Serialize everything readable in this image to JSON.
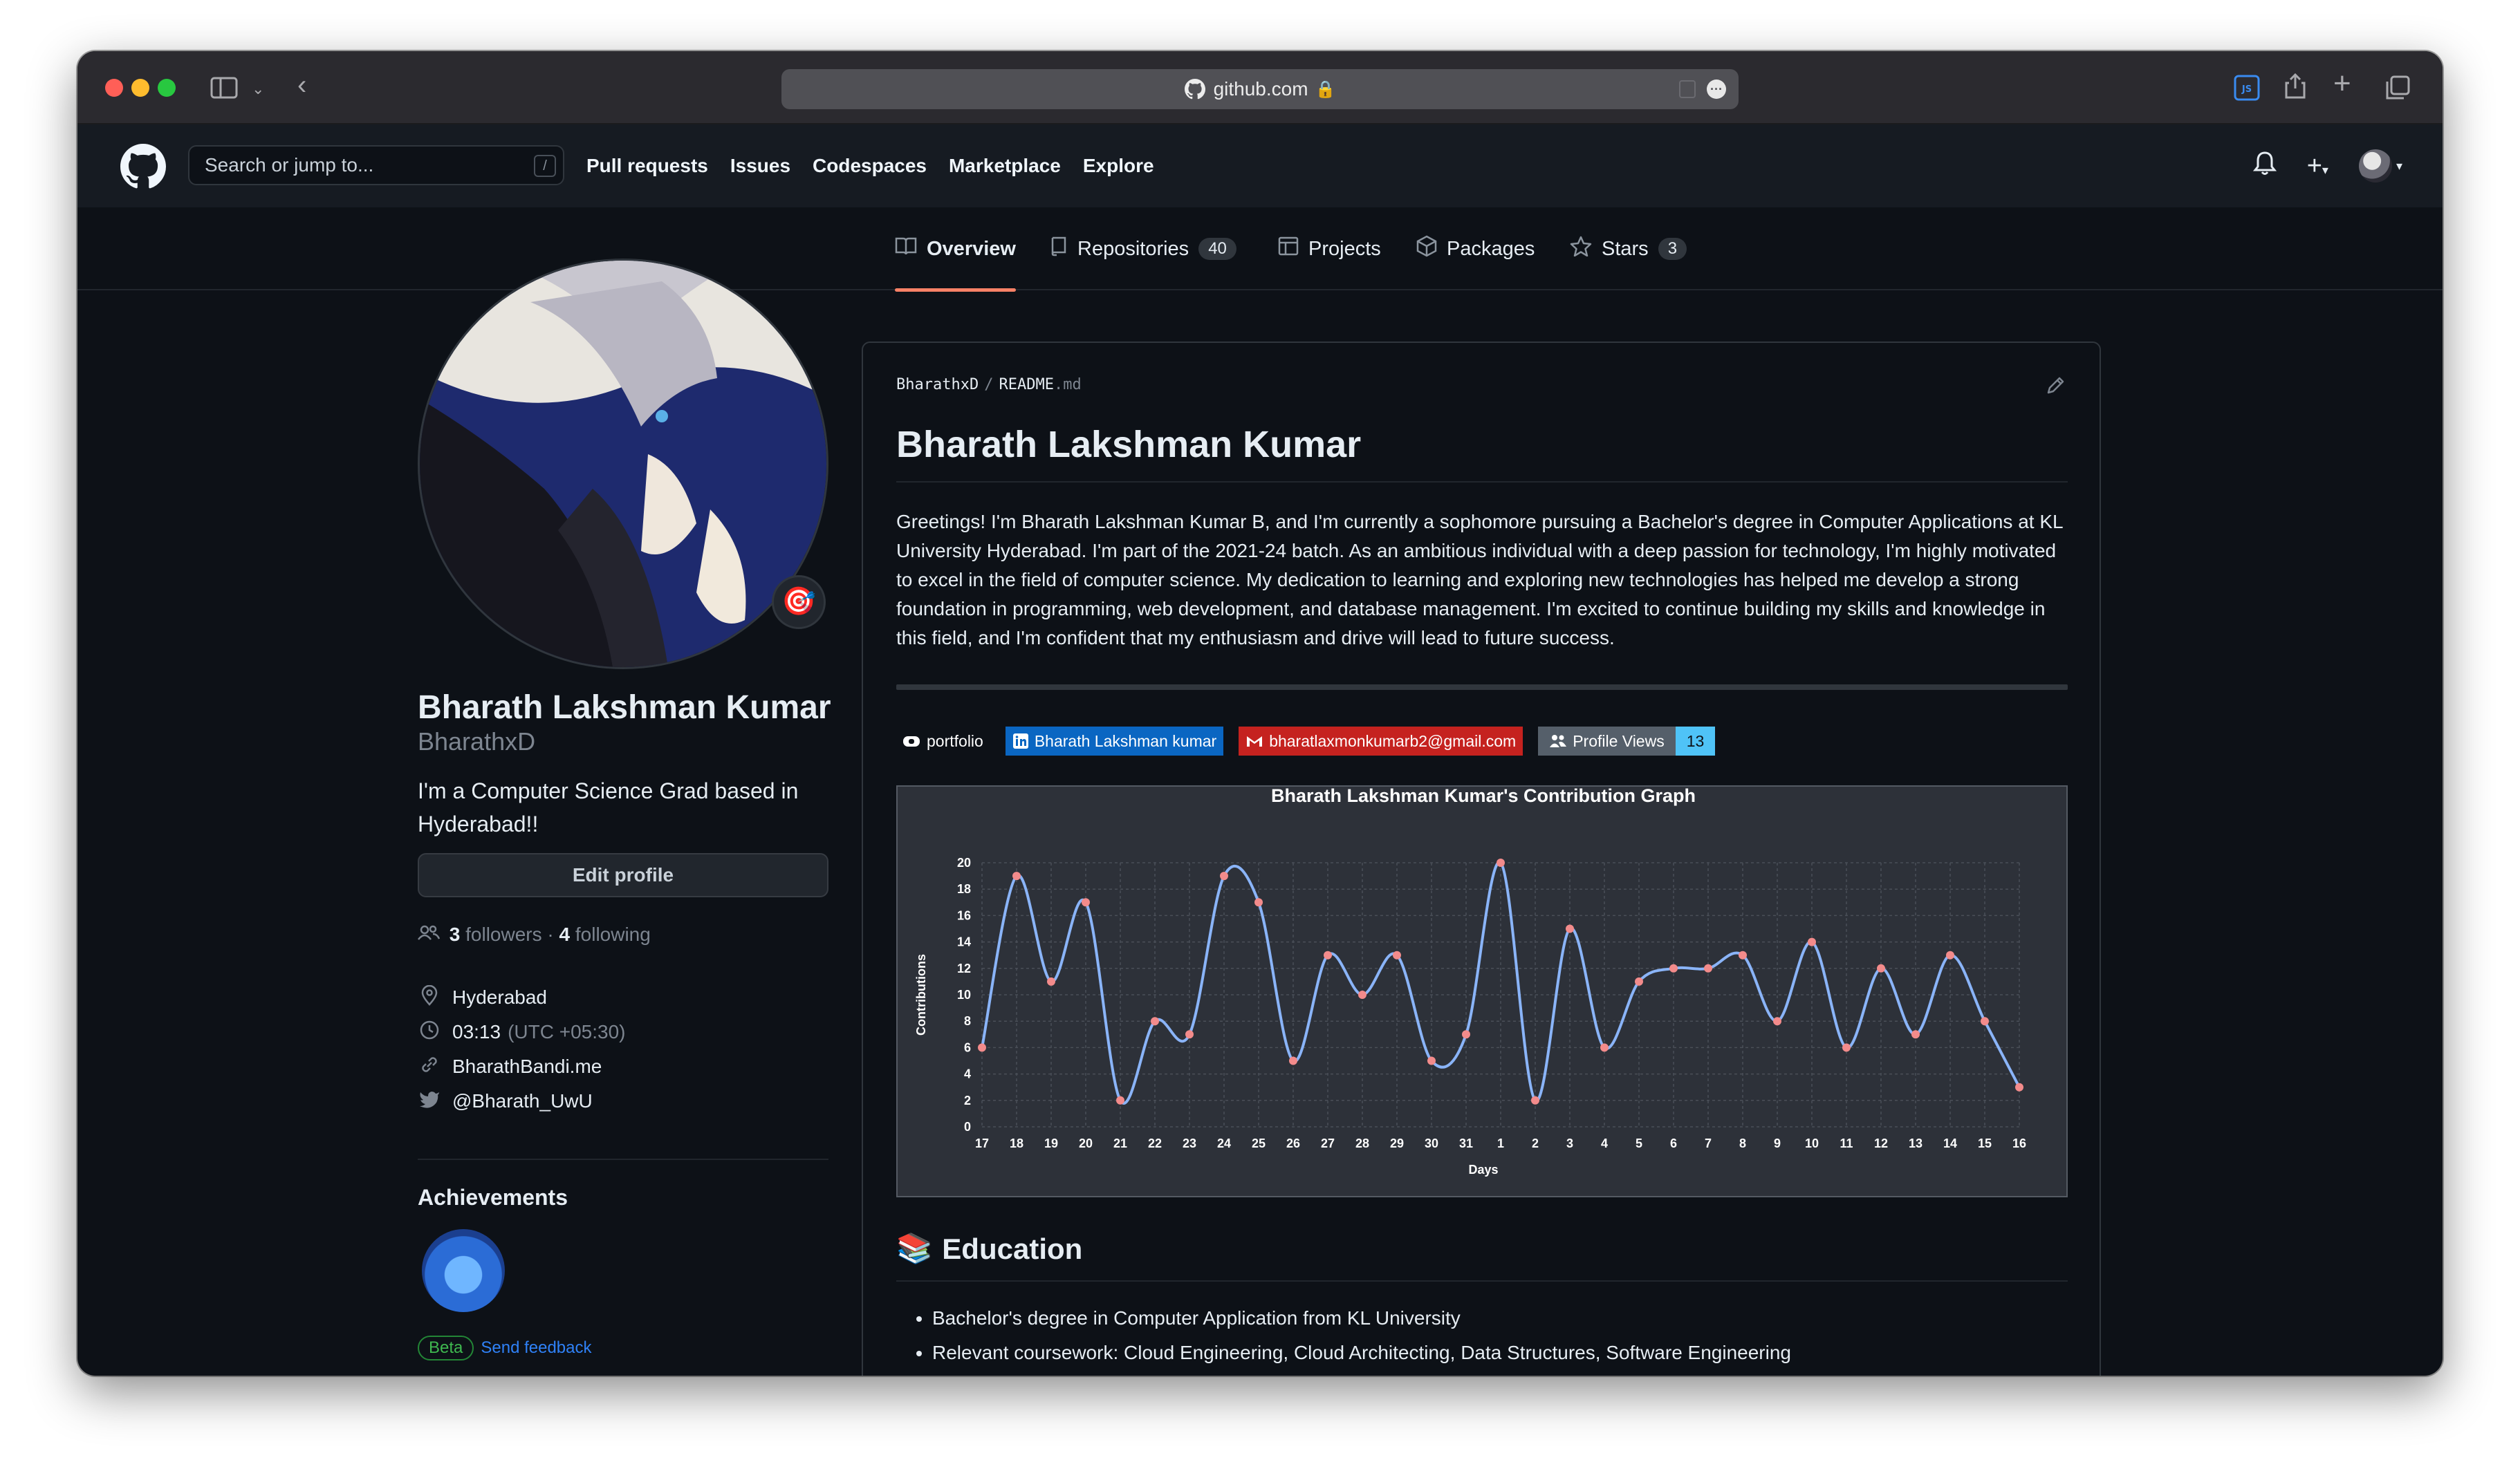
{
  "browser": {
    "url": "github.com"
  },
  "header": {
    "search_placeholder": "Search or jump to...",
    "search_shortcut": "/",
    "nav": [
      "Pull requests",
      "Issues",
      "Codespaces",
      "Marketplace",
      "Explore"
    ]
  },
  "tabs": [
    {
      "label": "Overview",
      "icon": "book-icon",
      "active": true
    },
    {
      "label": "Repositories",
      "count": "40",
      "icon": "repo-icon"
    },
    {
      "label": "Projects",
      "icon": "table-icon"
    },
    {
      "label": "Packages",
      "icon": "package-icon"
    },
    {
      "label": "Stars",
      "count": "3",
      "icon": "star-icon"
    }
  ],
  "profile": {
    "name": "Bharath Lakshman Kumar",
    "login": "BharathxD",
    "bio": "I'm a Computer Science Grad based in Hyderabad!!",
    "edit_label": "Edit profile",
    "followers_count": "3",
    "followers_label": "followers",
    "following_count": "4",
    "following_label": "following",
    "dot": "·",
    "location": "Hyderabad",
    "local_time": "03:13",
    "timezone": "(UTC +05:30)",
    "website": "BharathBandi.me",
    "twitter": "@Bharath_UwU",
    "achievements_title": "Achievements",
    "beta_label": "Beta",
    "feedback_label": "Send feedback"
  },
  "readme": {
    "owner": "BharathxD",
    "separator": "/",
    "file_name": "README",
    "file_ext": ".md",
    "title": "Bharath Lakshman Kumar",
    "intro": "Greetings! I'm Bharath Lakshman Kumar B, and I'm currently a sophomore pursuing a Bachelor's degree in Computer Applications at KL University Hyderabad. I'm part of the 2021-24 batch. As an ambitious individual with a deep passion for technology, I'm highly motivated to excel in the field of computer science. My dedication to learning and exploring new technologies has helped me develop a strong foundation in programming, web development, and database management. I'm excited to continue building my skills and knowledge in this field, and I'm confident that my enthusiasm and drive will lead to future success.",
    "badges": {
      "portfolio": "portfolio",
      "linkedin": "Bharath Lakshman kumar",
      "gmail": "bharatlaxmonkumarb2@gmail.com",
      "views_label": "Profile Views",
      "views_count": "13"
    },
    "education_emoji": "📚",
    "education_title": "Education",
    "education_items": [
      "Bachelor's degree in Computer Application from KL University",
      "Relevant coursework: Cloud Engineering, Cloud Architecting, Data Structures, Software Engineering"
    ]
  },
  "chart_data": {
    "type": "line",
    "title": "Bharath Lakshman Kumar's Contribution Graph",
    "xlabel": "Days",
    "ylabel": "Contributions",
    "categories": [
      "17",
      "18",
      "19",
      "20",
      "21",
      "22",
      "23",
      "24",
      "25",
      "26",
      "27",
      "28",
      "29",
      "30",
      "31",
      "1",
      "2",
      "3",
      "4",
      "5",
      "6",
      "7",
      "8",
      "9",
      "10",
      "11",
      "12",
      "13",
      "14",
      "15",
      "16"
    ],
    "values": [
      6,
      19,
      11,
      17,
      2,
      8,
      7,
      19,
      17,
      5,
      13,
      10,
      13,
      5,
      7,
      20,
      2,
      15,
      6,
      11,
      12,
      12,
      13,
      8,
      14,
      6,
      12,
      7,
      13,
      8,
      3
    ],
    "yticks": [
      0,
      2,
      4,
      6,
      8,
      10,
      12,
      14,
      16,
      18,
      20
    ],
    "ylim": [
      0,
      20
    ],
    "grid": true,
    "colors": {
      "line": "#8ab4f8",
      "point": "#f38b8b",
      "background": "#2d3139",
      "grid": "#4a4f58",
      "text": "#ffffff"
    }
  }
}
